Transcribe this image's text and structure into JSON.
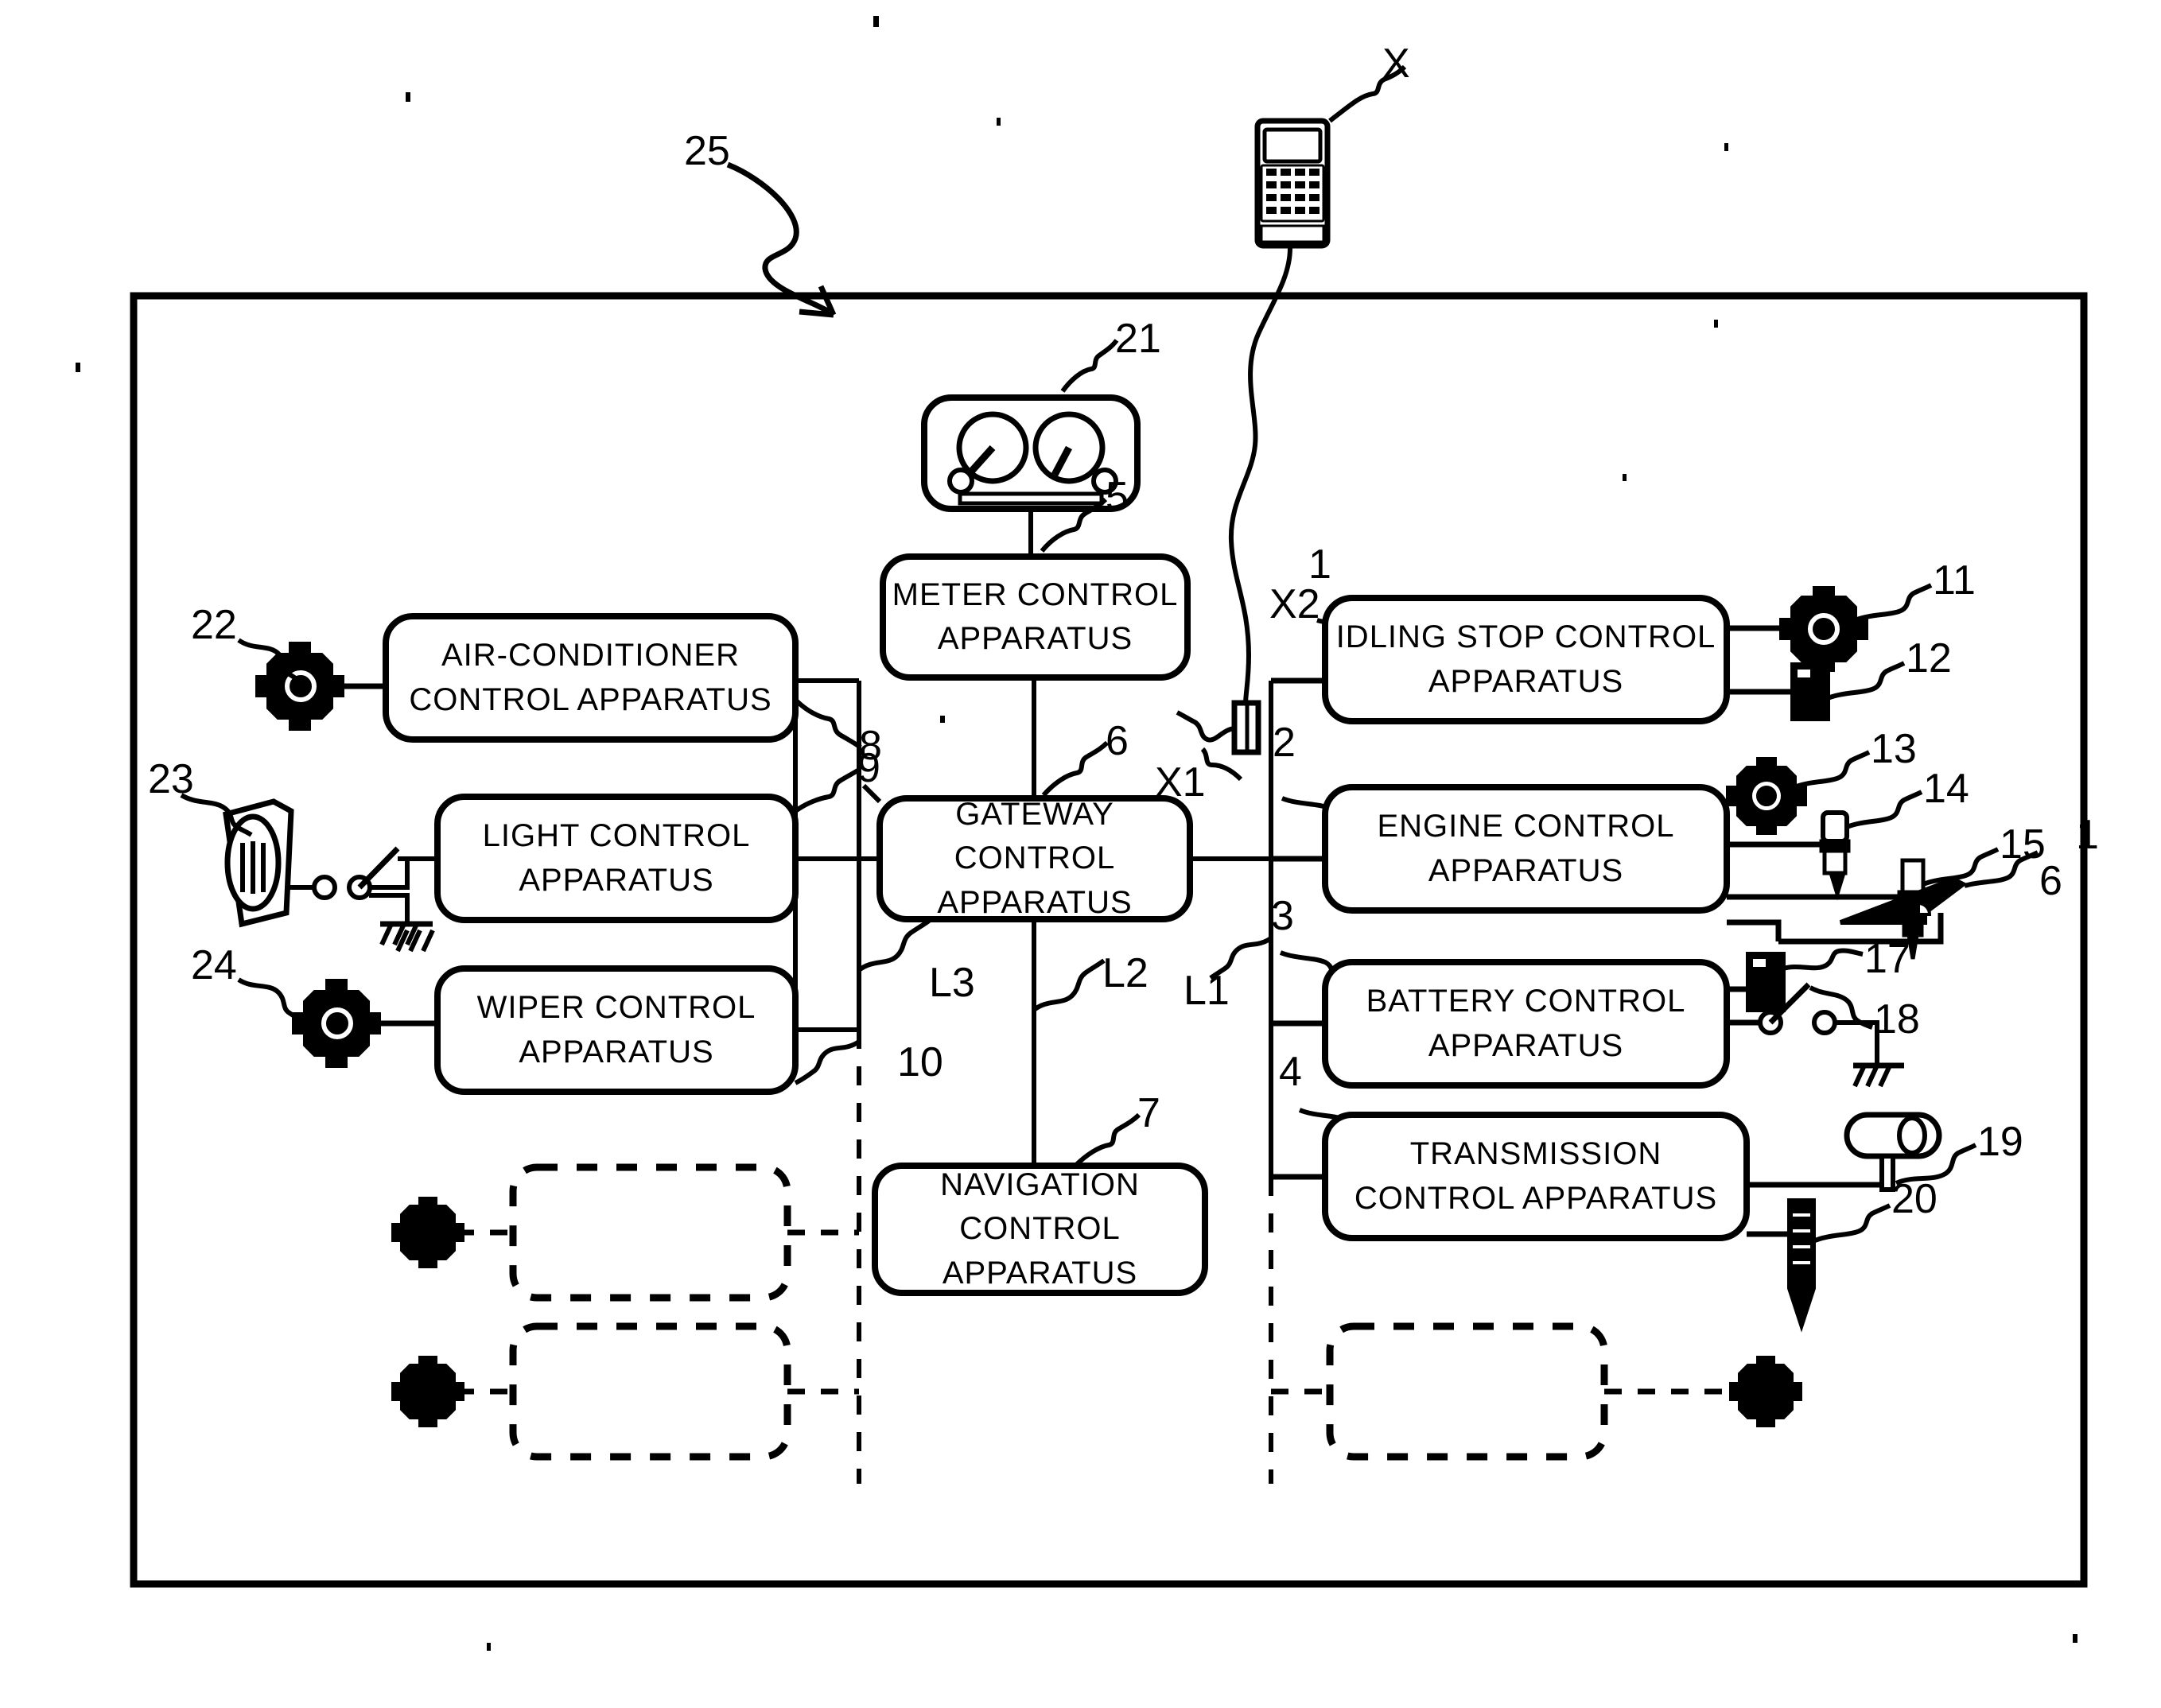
{
  "figure": {
    "type": "patent-block-diagram",
    "subject": "Vehicle control apparatus network with gateway and diagnostic tool",
    "outer_frame_ref": "25"
  },
  "blocks": [
    {
      "id": "meter",
      "label": "METER CONTROL APPARATUS",
      "ref": "5"
    },
    {
      "id": "gateway",
      "label": "GATEWAY CONTROL APPARATUS",
      "ref": "6"
    },
    {
      "id": "navigation",
      "label": "NAVIGATION CONTROL APPARATUS",
      "ref": "7"
    },
    {
      "id": "airconditioner",
      "label": "AIR-CONDITIONER CONTROL APPARATUS",
      "ref": "8"
    },
    {
      "id": "light",
      "label": "LIGHT CONTROL APPARATUS",
      "ref": "9"
    },
    {
      "id": "wiper",
      "label": "WIPER CONTROL APPARATUS",
      "ref": "10"
    },
    {
      "id": "idling",
      "label": "IDLING STOP CONTROL APPARATUS",
      "ref": "1"
    },
    {
      "id": "engine",
      "label": "ENGINE CONTROL APPARATUS",
      "ref": "2"
    },
    {
      "id": "battery",
      "label": "BATTERY CONTROL APPARATUS",
      "ref": "3"
    },
    {
      "id": "transmission",
      "label": "TRANSMISSION CONTROL APPARATUS",
      "ref": "4"
    }
  ],
  "block_labels": {
    "meter": "METER CONTROL APPARATUS",
    "gateway": "GATEWAY CONTROL APPARATUS",
    "navigation": "NAVIGATION CONTROL APPARATUS",
    "airconditioner": "AIR-CONDITIONER CONTROL APPARATUS",
    "light": "LIGHT CONTROL APPARATUS",
    "wiper": "WIPER CONTROL APPARATUS",
    "idling": "IDLING STOP CONTROL APPARATUS",
    "engine": "ENGINE CONTROL APPARATUS",
    "battery": "BATTERY CONTROL APPARATUS",
    "transmission": "TRANSMISSION CONTROL APPARATUS"
  },
  "reference_numerals": {
    "frame": "25",
    "meter_cluster": "21",
    "meter_apparatus": "5",
    "gateway_apparatus": "6",
    "navigation_apparatus": "7",
    "airconditioner_apparatus": "8",
    "light_apparatus": "9",
    "wiper_apparatus": "10",
    "idling_apparatus": "1",
    "engine_apparatus": "2",
    "battery_apparatus": "3",
    "transmission_apparatus": "4",
    "idle_sensor_11": "11",
    "idle_actuator_12": "12",
    "engine_sensor_13": "13",
    "injector_14": "14",
    "spark_plug_15": "15",
    "accel_pedal_6": "6",
    "engine_label_1": "1",
    "battery_17": "17",
    "battery_switch_18": "18",
    "shift_lever_19": "19",
    "transmission_sensor_20": "20",
    "ac_sensor_22": "22",
    "light_switch_23": "23",
    "wiper_sensor_24": "24"
  },
  "bus_labels": {
    "L1": "L1",
    "L2": "L2",
    "L3": "L3"
  },
  "connector_labels": {
    "X": "X",
    "X1": "X1",
    "X2": "X2"
  },
  "icons": {
    "diagnostic_tool": "handheld-diagnostic-tool-icon",
    "meter_cluster": "instrument-cluster-icon",
    "sensor": "round-sensor-icon",
    "gear_sensor": "gear-icon",
    "actuator_block": "actuator-icon",
    "injector": "fuel-injector-icon",
    "spark_plug": "spark-plug-icon",
    "accel_pedal": "accelerator-pedal-icon",
    "light_lamp": "lamp-icon",
    "switch": "toggle-switch-icon",
    "ground": "ground-symbol-icon",
    "shift_lever": "shift-lever-icon",
    "solenoid": "solenoid-icon",
    "connector": "wire-connector-icon"
  },
  "colors": {
    "ink": "#000000",
    "paper": "#ffffff"
  }
}
